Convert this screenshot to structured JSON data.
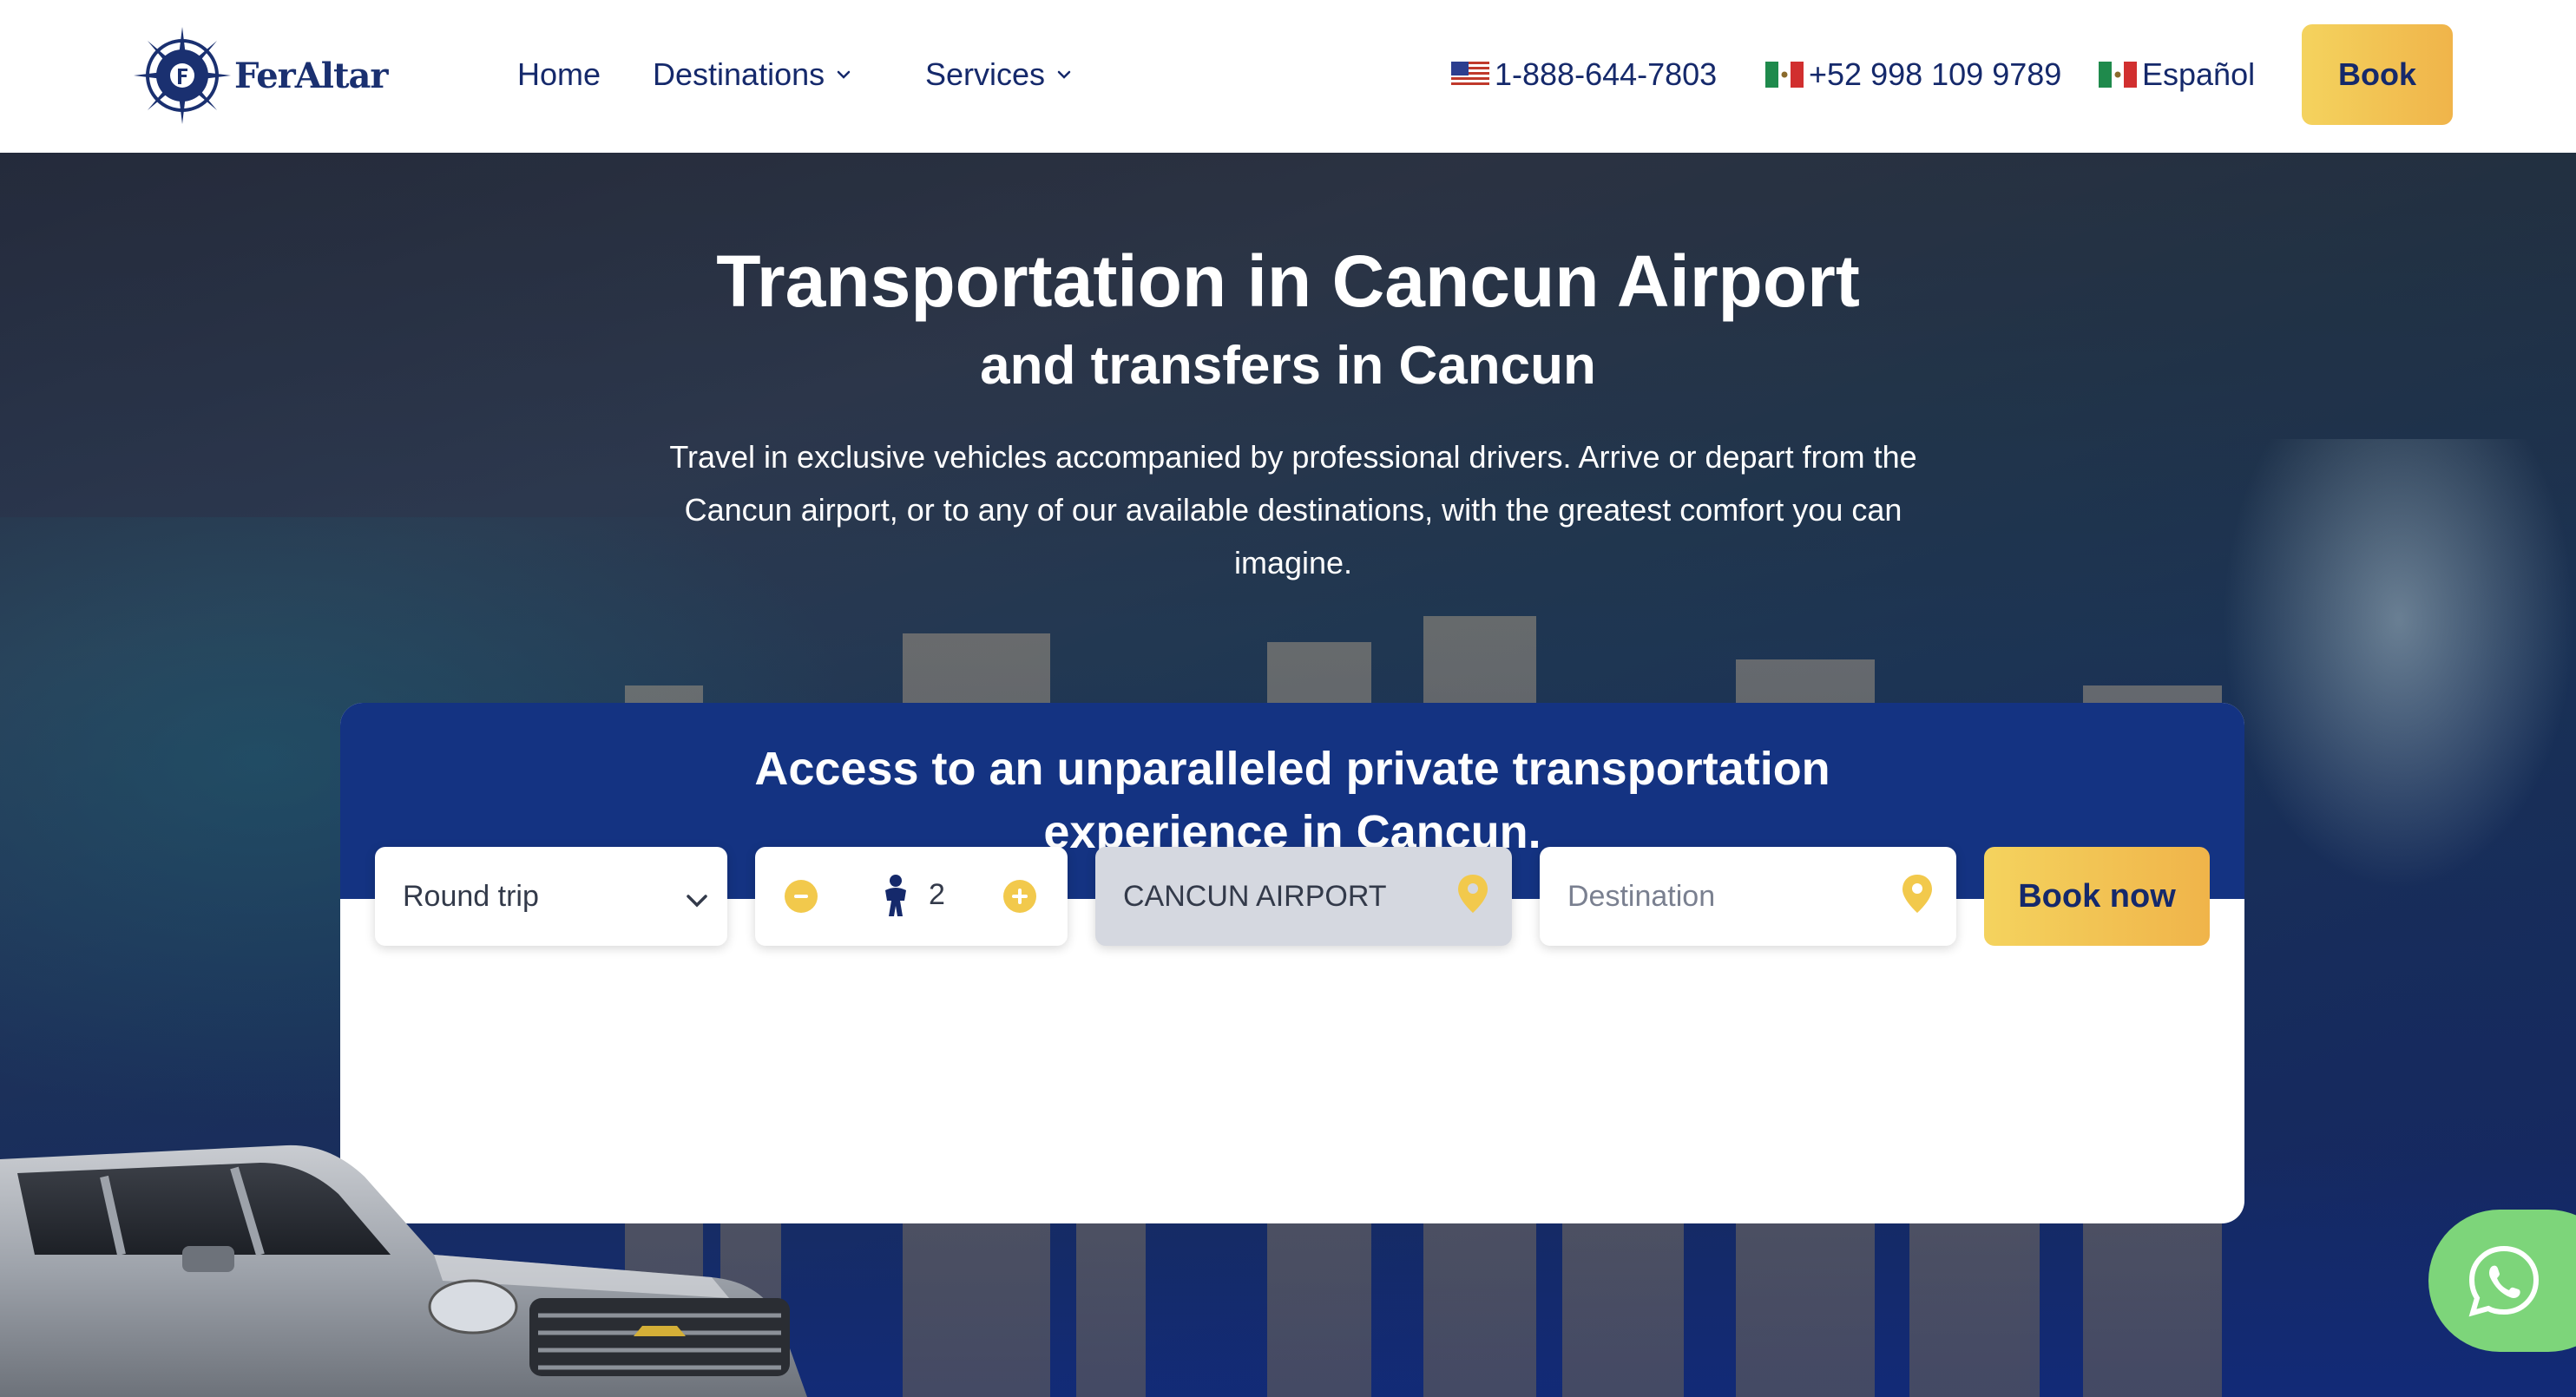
{
  "header": {
    "logo_text": "FerAltar",
    "nav": [
      {
        "label": "Home"
      },
      {
        "label": "Destinations",
        "has_dropdown": true
      },
      {
        "label": "Services",
        "has_dropdown": true
      }
    ],
    "phone_us": {
      "flag": "us-flag-icon",
      "label": "1-888-644-7803"
    },
    "phone_mx": {
      "flag": "mx-flag-icon",
      "label": "+52 998 109 9789"
    },
    "language": {
      "flag": "mx-flag-icon",
      "label": "Español"
    },
    "book_label": "Book"
  },
  "hero": {
    "title": "Transportation in Cancun Airport",
    "subtitle": "and transfers in Cancun",
    "description": "Travel in exclusive vehicles accompanied by professional drivers. Arrive or depart from the Cancun airport, or to any of our available destinations, with the greatest comfort you can imagine."
  },
  "booking": {
    "heading": "Access to an unparalleled private transportation experience in Cancun.",
    "trip_type": {
      "selected": "Round trip",
      "icon": "chevron-down-icon"
    },
    "passengers": {
      "value": "2",
      "decrement_icon": "minus-icon",
      "increment_icon": "plus-icon",
      "icon": "person-icon"
    },
    "origin": {
      "value": "CANCUN AIRPORT",
      "icon": "map-pin-icon"
    },
    "destination": {
      "placeholder": "Destination",
      "icon": "map-pin-icon"
    },
    "submit_label": "Book now"
  },
  "widgets": {
    "whatsapp_icon": "whatsapp-icon"
  },
  "colors": {
    "brand_navy": "#143382",
    "nav_text": "#15296b",
    "accent_gold_start": "#f4d35e",
    "accent_gold_end": "#f0b44a",
    "whatsapp_green": "#7dd57a"
  }
}
